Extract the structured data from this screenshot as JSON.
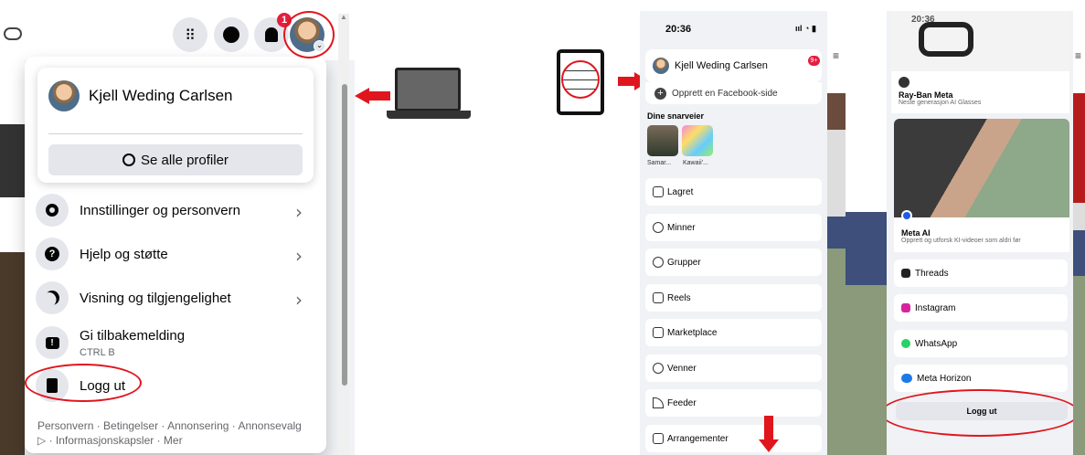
{
  "desktop": {
    "notification_count": "1",
    "profile_name": "Kjell Weding Carlsen",
    "see_all_profiles": "Se alle profiler",
    "menu": [
      {
        "label": "Innstillinger og personvern",
        "icon": "gear-icon",
        "chevron": true
      },
      {
        "label": "Hjelp og støtte",
        "icon": "question-icon",
        "chevron": true
      },
      {
        "label": "Visning og tilgjengelighet",
        "icon": "moon-icon",
        "chevron": true
      }
    ],
    "feedback": {
      "label": "Gi tilbakemelding",
      "shortcut": "CTRL B"
    },
    "logout": "Logg ut",
    "footer_line1": "Personvern · Betingelser · Annonsering · Annonsevalg",
    "footer_line2": "▷ · Informasjonskapsler · Mer"
  },
  "phone1": {
    "time": "20:36",
    "profile_name": "Kjell Weding Carlsen",
    "badge": "9+",
    "create_page": "Opprett en Facebook-side",
    "shortcuts_title": "Dine snarveier",
    "shortcuts": [
      "Samar...",
      "Kawaii'..."
    ],
    "items": [
      "Lagret",
      "Minner",
      "Grupper",
      "Reels",
      "Marketplace",
      "Venner",
      "Feeder",
      "Arrangementer"
    ]
  },
  "phone2": {
    "time": "20:36",
    "rayban_title": "Ray-Ban Meta",
    "rayban_sub": "Neste generasjon AI Glasses",
    "metaai_title": "Meta AI",
    "metaai_sub": "Opprett og utforsk KI-videoer som aldri før",
    "apps": [
      {
        "label": "Threads",
        "color": "#222222"
      },
      {
        "label": "Instagram",
        "color": "#d6249f"
      },
      {
        "label": "WhatsApp",
        "color": "#25d366"
      },
      {
        "label": "Meta Horizon",
        "color": "#1c7ae6"
      }
    ],
    "logout": "Logg ut"
  },
  "colors": {
    "accent_red": "#e0161e",
    "fb_blue": "#1877f2"
  }
}
